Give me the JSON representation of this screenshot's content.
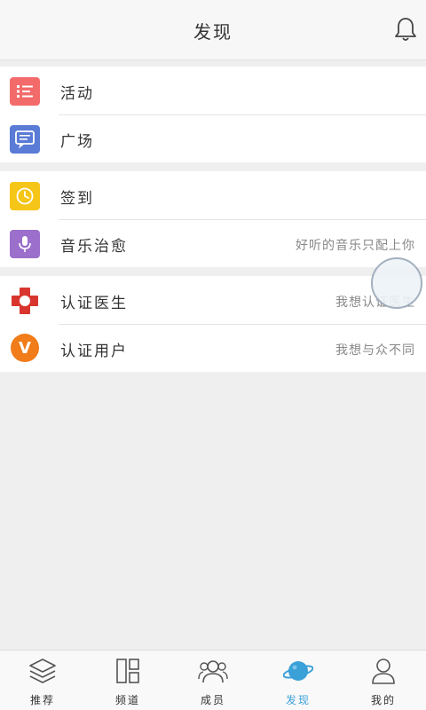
{
  "header": {
    "title": "发现"
  },
  "groups": {
    "g1": [
      {
        "label": "活动",
        "icon": "list-icon",
        "color": "#f36a6a"
      },
      {
        "label": "广场",
        "icon": "chat-icon",
        "color": "#5a7bd6"
      }
    ],
    "g2": [
      {
        "label": "签到",
        "icon": "clock-icon",
        "color": "#f5c518"
      },
      {
        "label": "音乐治愈",
        "hint": "好听的音乐只配上你",
        "icon": "mic-icon",
        "color": "#9b6fcb"
      }
    ],
    "g3": [
      {
        "label": "认证医生",
        "hint": "我想认证医生",
        "icon": "medical-cross-icon",
        "color": "#d9352f"
      },
      {
        "label": "认证用户",
        "hint": "我想与众不同",
        "icon": "v-badge-icon",
        "color": "#f07c1a",
        "icon_text": "V"
      }
    ]
  },
  "tabs": [
    {
      "label": "推荐",
      "icon": "layers-icon"
    },
    {
      "label": "频道",
      "icon": "grid-icon"
    },
    {
      "label": "成员",
      "icon": "users-icon"
    },
    {
      "label": "发现",
      "icon": "planet-icon",
      "active": true
    },
    {
      "label": "我的",
      "icon": "person-icon"
    }
  ],
  "colors": {
    "accent": "#3aa0d8",
    "background": "#efefef"
  }
}
